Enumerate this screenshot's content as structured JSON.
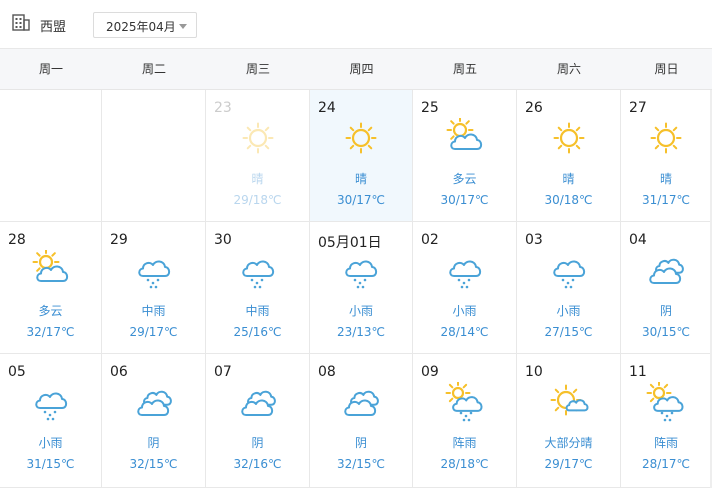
{
  "header": {
    "city": "西盟",
    "month": "2025年04月",
    "city_icon": "building-icon"
  },
  "weekdays": [
    "周一",
    "周二",
    "周三",
    "周四",
    "周五",
    "周六",
    "周日"
  ],
  "days": [
    {
      "date": "",
      "condition": "",
      "temp": "",
      "icon": ""
    },
    {
      "date": "",
      "condition": "",
      "temp": "",
      "icon": ""
    },
    {
      "date": "23",
      "condition": "晴",
      "temp": "29/18℃",
      "icon": "sun-icon",
      "past": true
    },
    {
      "date": "24",
      "condition": "晴",
      "temp": "30/17℃",
      "icon": "sun-icon",
      "today": true
    },
    {
      "date": "25",
      "condition": "多云",
      "temp": "30/17℃",
      "icon": "partly-cloudy-icon"
    },
    {
      "date": "26",
      "condition": "晴",
      "temp": "30/18℃",
      "icon": "sun-icon"
    },
    {
      "date": "27",
      "condition": "晴",
      "temp": "31/17℃",
      "icon": "sun-icon"
    },
    {
      "date": "28",
      "condition": "多云",
      "temp": "32/17℃",
      "icon": "partly-cloudy-icon"
    },
    {
      "date": "29",
      "condition": "中雨",
      "temp": "29/17℃",
      "icon": "rain-icon"
    },
    {
      "date": "30",
      "condition": "中雨",
      "temp": "25/16℃",
      "icon": "rain-icon"
    },
    {
      "date": "05月01日",
      "condition": "小雨",
      "temp": "23/13℃",
      "icon": "rain-icon"
    },
    {
      "date": "02",
      "condition": "小雨",
      "temp": "28/14℃",
      "icon": "rain-icon"
    },
    {
      "date": "03",
      "condition": "小雨",
      "temp": "27/15℃",
      "icon": "rain-icon"
    },
    {
      "date": "04",
      "condition": "阴",
      "temp": "30/15℃",
      "icon": "overcast-icon"
    },
    {
      "date": "05",
      "condition": "小雨",
      "temp": "31/15℃",
      "icon": "rain-icon"
    },
    {
      "date": "06",
      "condition": "阴",
      "temp": "32/15℃",
      "icon": "overcast-icon"
    },
    {
      "date": "07",
      "condition": "阴",
      "temp": "32/16℃",
      "icon": "overcast-icon"
    },
    {
      "date": "08",
      "condition": "阴",
      "temp": "32/15℃",
      "icon": "overcast-icon"
    },
    {
      "date": "09",
      "condition": "阵雨",
      "temp": "28/18℃",
      "icon": "shower-icon"
    },
    {
      "date": "10",
      "condition": "大部分晴",
      "temp": "29/17℃",
      "icon": "mostly-sunny-icon"
    },
    {
      "date": "11",
      "condition": "阵雨",
      "temp": "28/17℃",
      "icon": "shower-icon"
    }
  ],
  "colors": {
    "sun": "#f6c02a",
    "cloud": "#4aa3d8",
    "text_blue": "#3a8ed2",
    "today_bg": "#f1f8fd"
  }
}
